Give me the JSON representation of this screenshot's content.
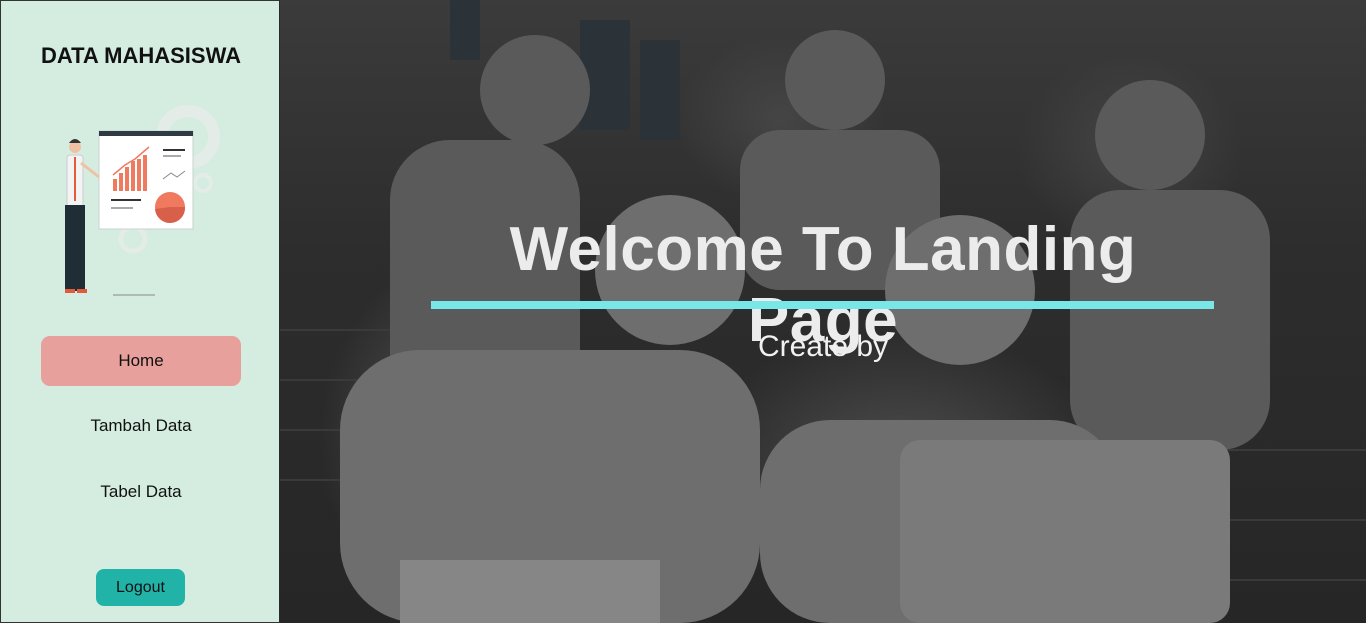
{
  "sidebar": {
    "brand": "DATA MAHASISWA",
    "illustration": "presenter-chart-illustration",
    "nav": [
      {
        "label": "Home",
        "active": true
      },
      {
        "label": "Tambah Data",
        "active": false
      },
      {
        "label": "Tabel Data",
        "active": false
      }
    ],
    "logout_label": "Logout"
  },
  "hero": {
    "title": "Welcome To Landing Page",
    "subtitle": "Create by",
    "background": "students-on-stairs-photo"
  },
  "colors": {
    "sidebar_bg": "#d4ede0",
    "active_nav": "#e8a09c",
    "logout": "#21b3a8",
    "underline": "#79e6e8"
  }
}
